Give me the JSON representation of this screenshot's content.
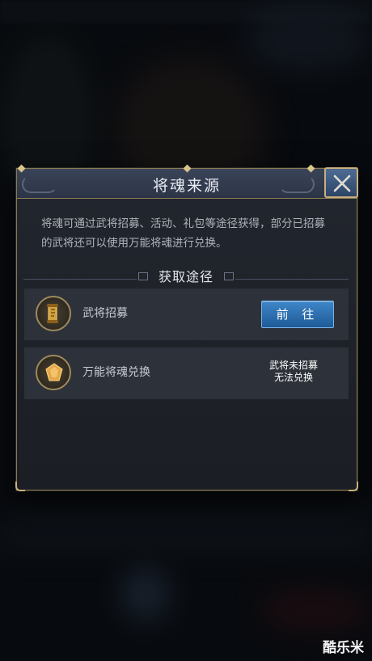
{
  "dialog": {
    "title": "将魂来源",
    "description": "将魂可通过武将招募、活动、礼包等途径获得，部分已招募的武将还可以使用万能将魂进行兑换。",
    "section_title": "获取途径",
    "sources": [
      {
        "label": "武将招募",
        "icon": "scroll-icon",
        "action_label": "前 往"
      },
      {
        "label": "万能将魂兑换",
        "icon": "soul-token-icon",
        "status_line1": "武将未招募",
        "status_line2": "无法兑换"
      }
    ]
  },
  "watermark": "酷乐米",
  "colors": {
    "accent_gold": "#c9b07a",
    "button_blue": "#2f72b3",
    "panel": "#1f2229"
  }
}
